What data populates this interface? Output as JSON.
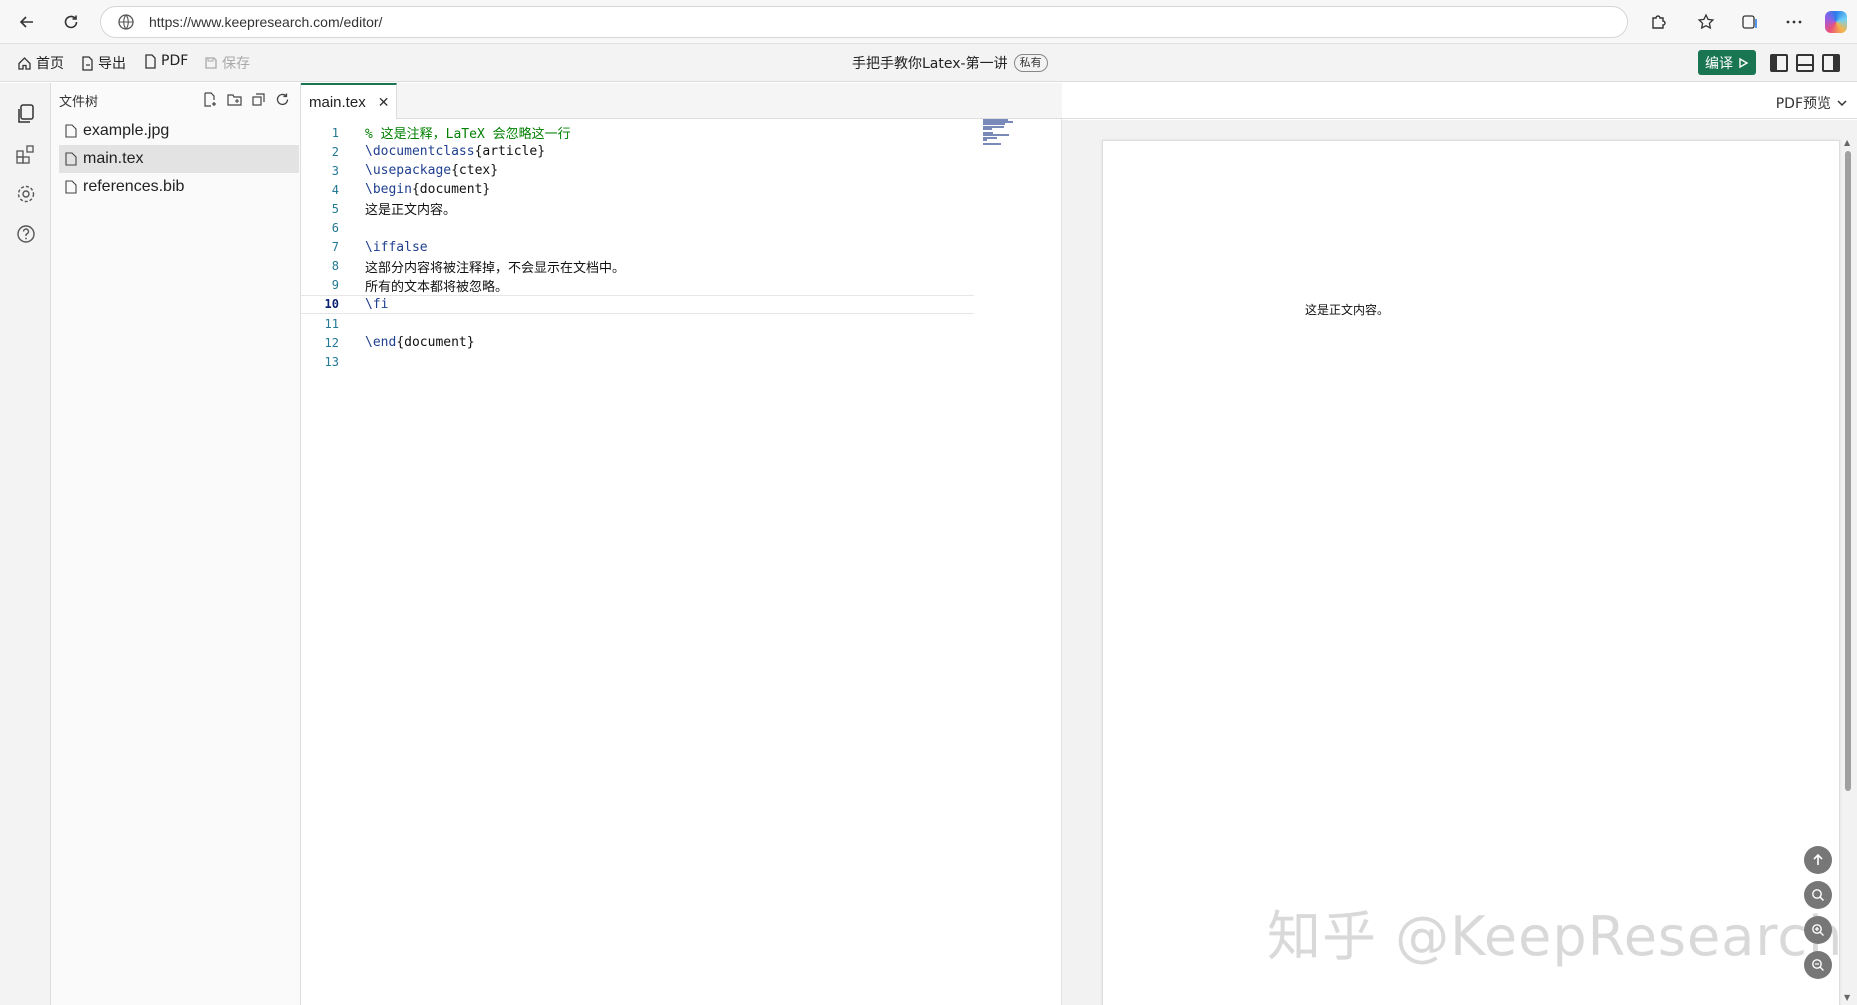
{
  "browser": {
    "url": "https://www.keepresearch.com/editor/"
  },
  "toolbar": {
    "home": "首页",
    "export": "导出",
    "pdf": "PDF",
    "save": "保存",
    "doc_title": "手把手教你Latex-第一讲",
    "privacy": "私有",
    "compile": "编译"
  },
  "file_tree": {
    "header": "文件树",
    "items": [
      "example.jpg",
      "main.tex",
      "references.bib"
    ],
    "selected": "main.tex"
  },
  "editor": {
    "tab": "main.tex",
    "active_line": 10,
    "lines": [
      {
        "n": "1",
        "text": "% 这是注释，LaTeX 会忽略这一行"
      },
      {
        "n": "2",
        "text": "\\documentclass{article}"
      },
      {
        "n": "3",
        "text": "\\usepackage{ctex}"
      },
      {
        "n": "4",
        "text": "\\begin{document}"
      },
      {
        "n": "5",
        "text": "这是正文内容。"
      },
      {
        "n": "6",
        "text": ""
      },
      {
        "n": "7",
        "text": "\\iffalse"
      },
      {
        "n": "8",
        "text": "这部分内容将被注释掉，不会显示在文档中。"
      },
      {
        "n": "9",
        "text": "所有的文本都将被忽略。"
      },
      {
        "n": "10",
        "text": "\\fi"
      },
      {
        "n": "11",
        "text": ""
      },
      {
        "n": "12",
        "text": "\\end{document}"
      },
      {
        "n": "13",
        "text": ""
      }
    ]
  },
  "pdf": {
    "label": "PDF预览",
    "body_text": "这是正文内容。",
    "watermark": "知乎 @KeepResearch"
  },
  "colors": {
    "accent": "#1a7553",
    "comment": "#008000",
    "keyword": "#1f3f8f",
    "line_number": "#237893"
  }
}
